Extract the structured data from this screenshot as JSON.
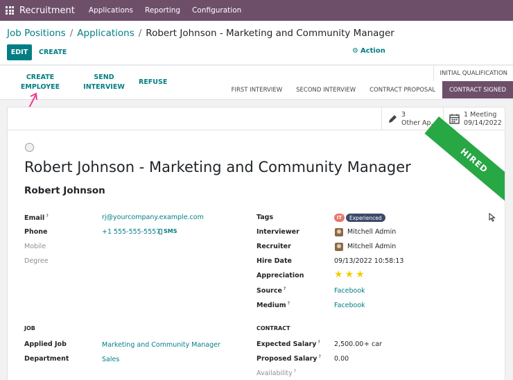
{
  "topbar": {
    "brand": "Recruitment",
    "menus": [
      "Applications",
      "Reporting",
      "Configuration"
    ],
    "icon": "apps-grid-icon"
  },
  "breadcrumb": {
    "items": [
      "Job Positions",
      "Applications"
    ],
    "current": "Robert Johnson - Marketing and Community Manager"
  },
  "controls": {
    "edit_label": "EDIT",
    "create_label": "CREATE",
    "action_label": "Action",
    "action_icon": "gear-icon"
  },
  "header_buttons": {
    "create_employee": [
      "CREATE",
      "EMPLOYEE"
    ],
    "send_interview": [
      "SEND",
      "INTERVIEW"
    ],
    "refuse": "REFUSE"
  },
  "stages": {
    "items": [
      "FIRST INTERVIEW",
      "SECOND INTERVIEW",
      "CONTRACT PROPOSAL",
      "CONTRACT SIGNED"
    ],
    "overflow": "INITIAL QUALIFICATION",
    "active": "CONTRACT SIGNED",
    "active_color": "#6e4f6a"
  },
  "stat_buttons": [
    {
      "count": "3",
      "label": "Other Ap...",
      "icon": "pencil-icon"
    },
    {
      "count": "1 Meeting",
      "label": "09/14/2022",
      "icon": "calendar-icon"
    }
  ],
  "ribbon": {
    "label": "HIRED",
    "color": "#28a745"
  },
  "applicant": {
    "title": "Robert Johnson - Marketing and Community Manager",
    "name": "Robert Johnson"
  },
  "left_fields": {
    "email_label": "Email",
    "email_value": "rj@yourcompany.example.com",
    "phone_label": "Phone",
    "phone_value": "+1 555-555-5557",
    "sms_label": "SMS",
    "mobile_label": "Mobile",
    "degree_label": "Degree"
  },
  "right_fields": {
    "tags_label": "Tags",
    "tags": [
      "IT",
      "Experienced"
    ],
    "interviewer_label": "Interviewer",
    "interviewer_value": "Mitchell Admin",
    "recruiter_label": "Recruiter",
    "recruiter_value": "Mitchell Admin",
    "hire_date_label": "Hire Date",
    "hire_date_value": "09/13/2022 10:58:13",
    "appreciation_label": "Appreciation",
    "appreciation_stars": 3,
    "appreciation_max": 3,
    "source_label": "Source",
    "source_value": "Facebook",
    "medium_label": "Medium",
    "medium_value": "Facebook"
  },
  "job_section": {
    "heading": "JOB",
    "applied_job_label": "Applied Job",
    "applied_job_value": "Marketing and Community Manager",
    "department_label": "Department",
    "department_value": "Sales"
  },
  "contract_section": {
    "heading": "CONTRACT",
    "expected_salary_label": "Expected Salary",
    "expected_salary_value": "2,500.00",
    "expected_extra": "+  car",
    "proposed_salary_label": "Proposed Salary",
    "proposed_salary_value": "0.00",
    "availability_label": "Availability"
  },
  "help_mark": "?"
}
